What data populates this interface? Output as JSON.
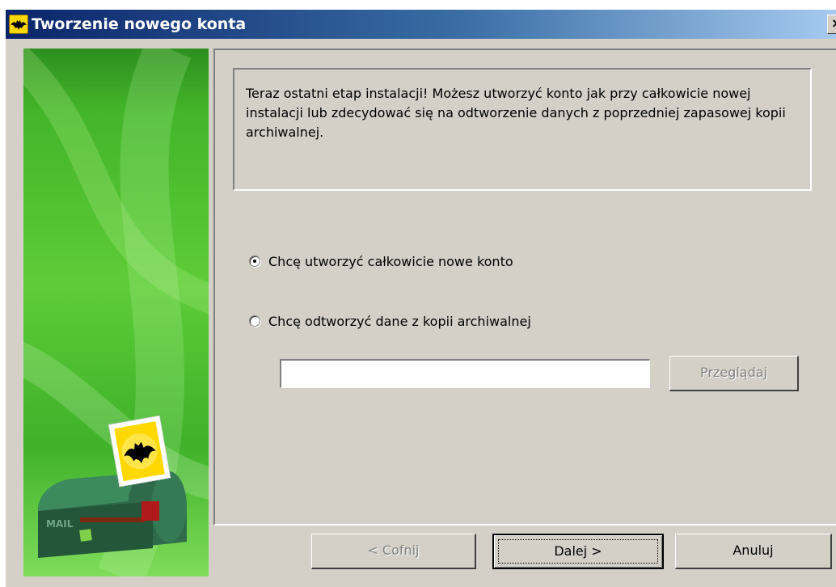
{
  "window": {
    "title": "Tworzenie nowego konta",
    "close_label": "×"
  },
  "info": {
    "text": "Teraz ostatni etap instalacji! Możesz utworzyć konto jak przy całkowicie nowej instalacji lub zdecydować się na odtworzenie danych z poprzedniej zapasowej kopii archiwalnej."
  },
  "options": {
    "new_account": {
      "label": "Chcę utworzyć całkowicie nowe konto",
      "checked": true
    },
    "restore": {
      "label": "Chcę odtworzyć dane z kopii archiwalnej",
      "checked": false
    }
  },
  "restore_path": {
    "value": ""
  },
  "buttons": {
    "browse": "Przeglądaj",
    "back": "< Cofnij",
    "next": "Dalej >",
    "cancel": "Anuluj"
  },
  "illustration": {
    "icon": "mailbox-with-bat-stamp-icon",
    "mailbox_text": "MAIL"
  },
  "colors": {
    "title_gradient_start": "#0a246a",
    "title_gradient_end": "#a6caf0",
    "dialog_face": "#d4d0c8",
    "side_green": "#44b52a"
  }
}
